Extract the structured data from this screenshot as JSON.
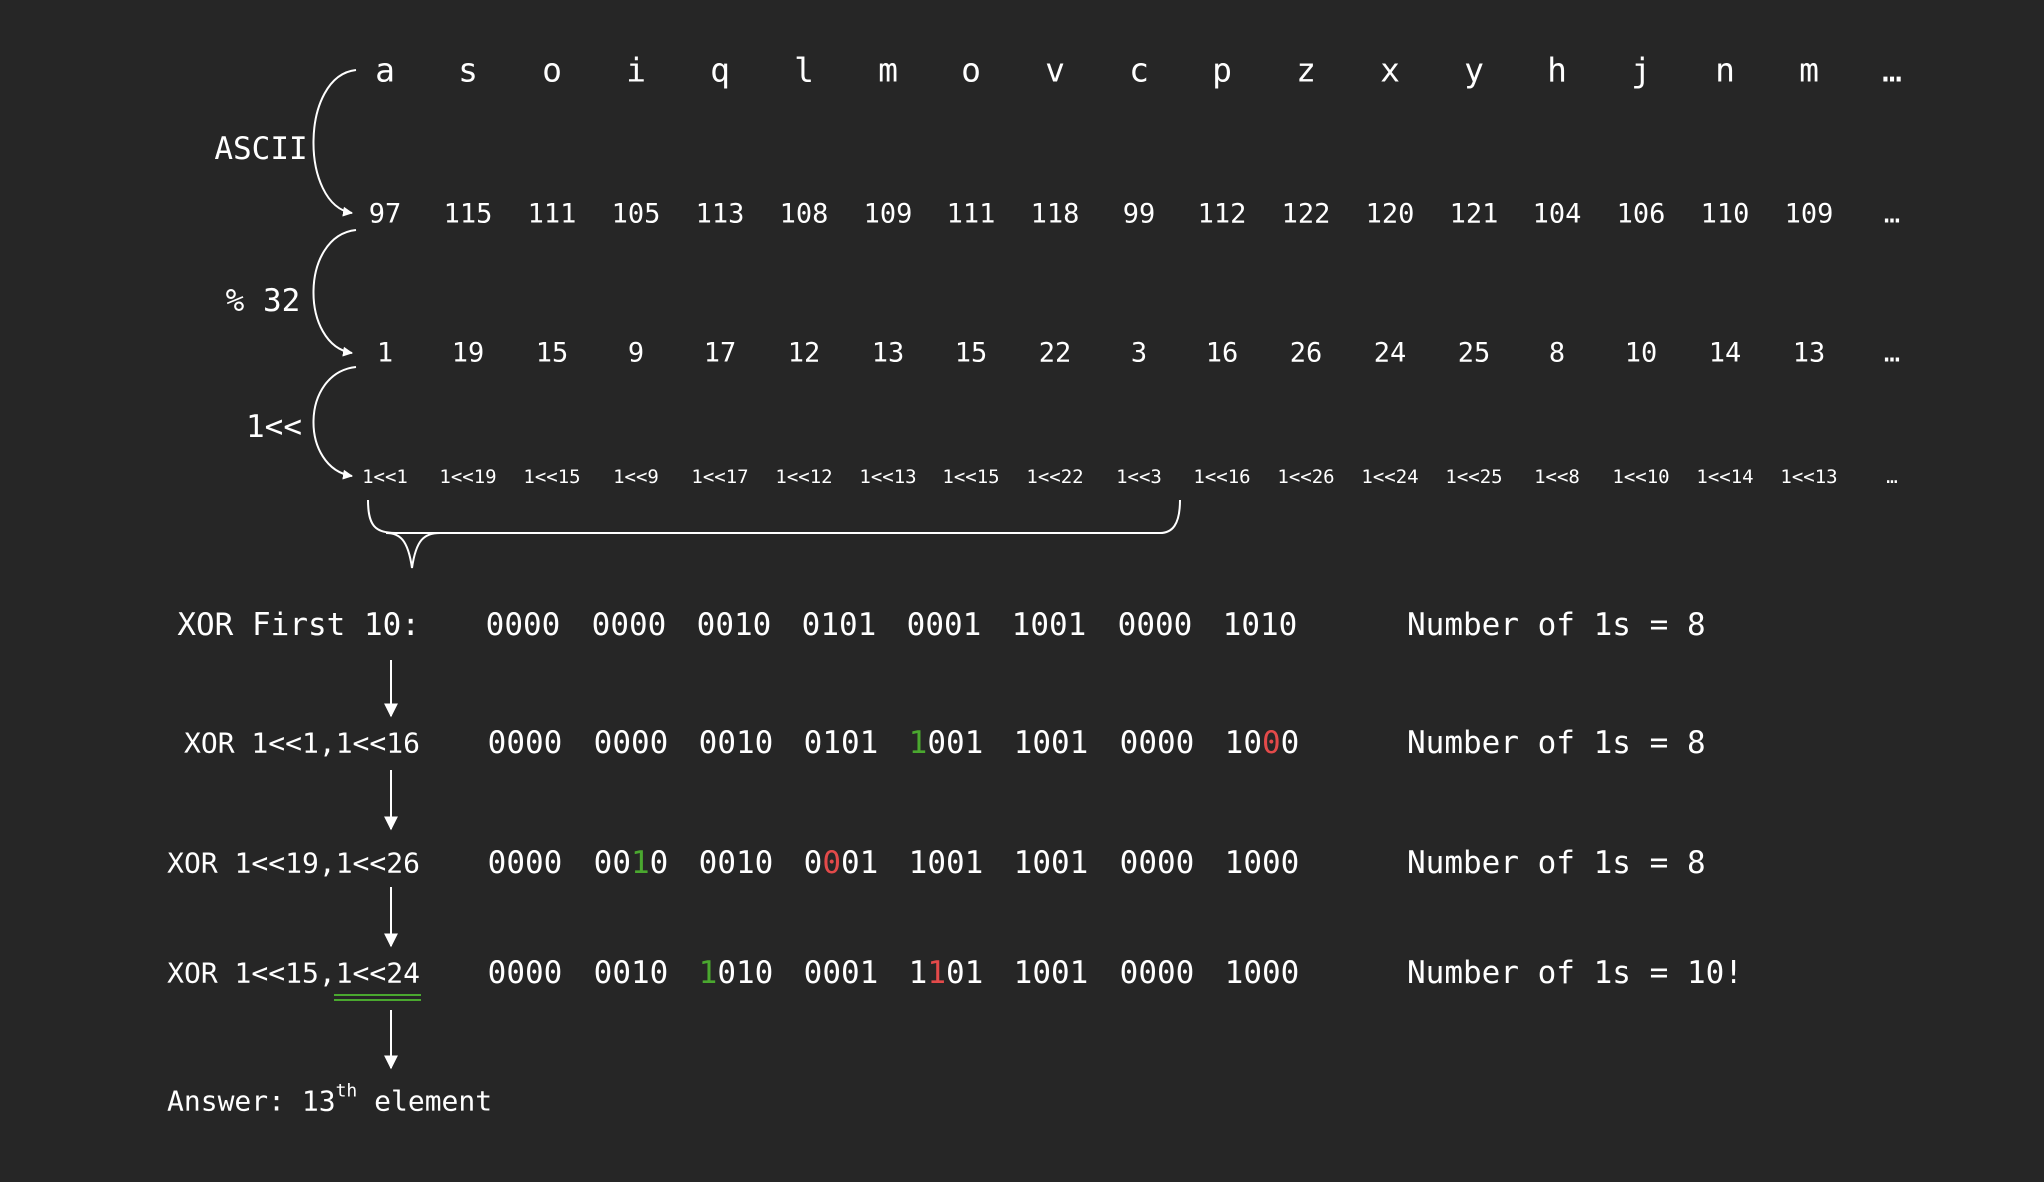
{
  "rows": {
    "letters": [
      "a",
      "s",
      "o",
      "i",
      "q",
      "l",
      "m",
      "o",
      "v",
      "c",
      "p",
      "z",
      "x",
      "y",
      "h",
      "j",
      "n",
      "m",
      "…"
    ],
    "ascii": [
      "97",
      "115",
      "111",
      "105",
      "113",
      "108",
      "109",
      "111",
      "118",
      "99",
      "112",
      "122",
      "120",
      "121",
      "104",
      "106",
      "110",
      "109",
      "…"
    ],
    "mod32": [
      "1",
      "19",
      "15",
      "9",
      "17",
      "12",
      "13",
      "15",
      "22",
      "3",
      "16",
      "26",
      "24",
      "25",
      "8",
      "10",
      "14",
      "13",
      "…"
    ],
    "shifts": [
      "1<<1",
      "1<<19",
      "1<<15",
      "1<<9",
      "1<<17",
      "1<<12",
      "1<<13",
      "1<<15",
      "1<<22",
      "1<<3",
      "1<<16",
      "1<<26",
      "1<<24",
      "1<<25",
      "1<<8",
      "1<<10",
      "1<<14",
      "1<<13",
      "…"
    ]
  },
  "step_labels": {
    "ascii": "ASCII",
    "mod": "% 32",
    "shift": "1<<"
  },
  "xor_steps": [
    {
      "label": "XOR First 10:",
      "groups": [
        [
          {
            "t": "0000"
          }
        ],
        [
          {
            "t": "0000"
          }
        ],
        [
          {
            "t": "0010"
          }
        ],
        [
          {
            "t": "0101"
          }
        ],
        [
          {
            "t": "0001"
          }
        ],
        [
          {
            "t": "1001"
          }
        ],
        [
          {
            "t": "0000"
          }
        ],
        [
          {
            "t": "1010"
          }
        ]
      ],
      "count": "Number of 1s = 8"
    },
    {
      "label": "XOR 1<<1,1<<16",
      "groups": [
        [
          {
            "t": "0000"
          }
        ],
        [
          {
            "t": "0000"
          }
        ],
        [
          {
            "t": "0010"
          }
        ],
        [
          {
            "t": "0101"
          }
        ],
        [
          {
            "t": "1",
            "c": "set"
          },
          {
            "t": "001"
          }
        ],
        [
          {
            "t": "1001"
          }
        ],
        [
          {
            "t": "0000"
          }
        ],
        [
          {
            "t": "10"
          },
          {
            "t": "0",
            "c": "clear"
          },
          {
            "t": "0"
          }
        ]
      ],
      "count": "Number of 1s = 8"
    },
    {
      "label": "XOR 1<<19,1<<26",
      "groups": [
        [
          {
            "t": "0000"
          }
        ],
        [
          {
            "t": "00"
          },
          {
            "t": "1",
            "c": "set"
          },
          {
            "t": "0"
          }
        ],
        [
          {
            "t": "0010"
          }
        ],
        [
          {
            "t": "0"
          },
          {
            "t": "0",
            "c": "clear"
          },
          {
            "t": "01"
          }
        ],
        [
          {
            "t": "1001"
          }
        ],
        [
          {
            "t": "1001"
          }
        ],
        [
          {
            "t": "0000"
          }
        ],
        [
          {
            "t": "1000"
          }
        ]
      ],
      "count": "Number of 1s = 8"
    },
    {
      "label": "XOR 1<<15,1<<24",
      "groups": [
        [
          {
            "t": "0000"
          }
        ],
        [
          {
            "t": "0010"
          }
        ],
        [
          {
            "t": "1",
            "c": "set"
          },
          {
            "t": "010"
          }
        ],
        [
          {
            "t": "0001"
          }
        ],
        [
          {
            "t": "1"
          },
          {
            "t": "1",
            "c": "clear"
          },
          {
            "t": "01"
          }
        ],
        [
          {
            "t": "1001"
          }
        ],
        [
          {
            "t": "0000"
          }
        ],
        [
          {
            "t": "1000"
          }
        ]
      ],
      "count": "Number of 1s = 10!"
    }
  ],
  "answer": {
    "prefix": "Answer: 13",
    "sup": "th",
    "suffix": " element"
  },
  "colors": {
    "background": "#262626",
    "text": "#ffffff",
    "set_bit": "#4aa82f",
    "clear_bit": "#e34a4a",
    "underline": "#4aa82f"
  }
}
